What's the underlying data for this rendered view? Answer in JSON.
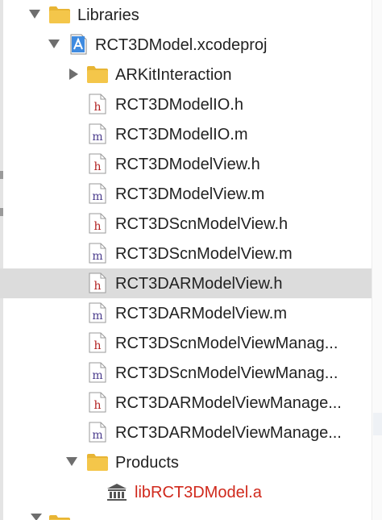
{
  "navigator": {
    "items": [
      {
        "label": "Libraries",
        "kind": "group",
        "expanded": true,
        "icon": "folder-icon"
      },
      {
        "label": "RCT3DModel.xcodeproj",
        "kind": "project",
        "expanded": true,
        "icon": "xcodeproj-icon"
      },
      {
        "label": "ARKitInteraction",
        "kind": "group",
        "expanded": false,
        "icon": "folder-icon"
      },
      {
        "label": "RCT3DModelIO.h",
        "kind": "header",
        "icon": "h-file-icon",
        "icon_letter": "h"
      },
      {
        "label": "RCT3DModelIO.m",
        "kind": "source",
        "icon": "m-file-icon",
        "icon_letter": "m"
      },
      {
        "label": "RCT3DModelView.h",
        "kind": "header",
        "icon": "h-file-icon",
        "icon_letter": "h"
      },
      {
        "label": "RCT3DModelView.m",
        "kind": "source",
        "icon": "m-file-icon",
        "icon_letter": "m"
      },
      {
        "label": "RCT3DScnModelView.h",
        "kind": "header",
        "icon": "h-file-icon",
        "icon_letter": "h"
      },
      {
        "label": "RCT3DScnModelView.m",
        "kind": "source",
        "icon": "m-file-icon",
        "icon_letter": "m"
      },
      {
        "label": "RCT3DARModelView.h",
        "kind": "header",
        "icon": "h-file-icon",
        "icon_letter": "h",
        "selected": true
      },
      {
        "label": "RCT3DARModelView.m",
        "kind": "source",
        "icon": "m-file-icon",
        "icon_letter": "m"
      },
      {
        "label": "RCT3DScnModelViewManag...",
        "kind": "header",
        "icon": "h-file-icon",
        "icon_letter": "h"
      },
      {
        "label": "RCT3DScnModelViewManag...",
        "kind": "source",
        "icon": "m-file-icon",
        "icon_letter": "m"
      },
      {
        "label": "RCT3DARModelViewManage...",
        "kind": "header",
        "icon": "h-file-icon",
        "icon_letter": "h"
      },
      {
        "label": "RCT3DARModelViewManage...",
        "kind": "source",
        "icon": "m-file-icon",
        "icon_letter": "m"
      },
      {
        "label": "Products",
        "kind": "group",
        "expanded": true,
        "icon": "folder-icon"
      },
      {
        "label": "libRCT3DModel.a",
        "kind": "product",
        "icon": "library-icon"
      }
    ]
  },
  "colors": {
    "folder": "#f4c64a",
    "folder_tab": "#e8b534",
    "selection": "#dcdcdc",
    "text": "#222222",
    "product_text": "#d0281b",
    "h_letter": "#b22222",
    "m_letter": "#4b3c8c",
    "project_blue": "#3f8be0",
    "disclosure": "#6e6e6e"
  }
}
